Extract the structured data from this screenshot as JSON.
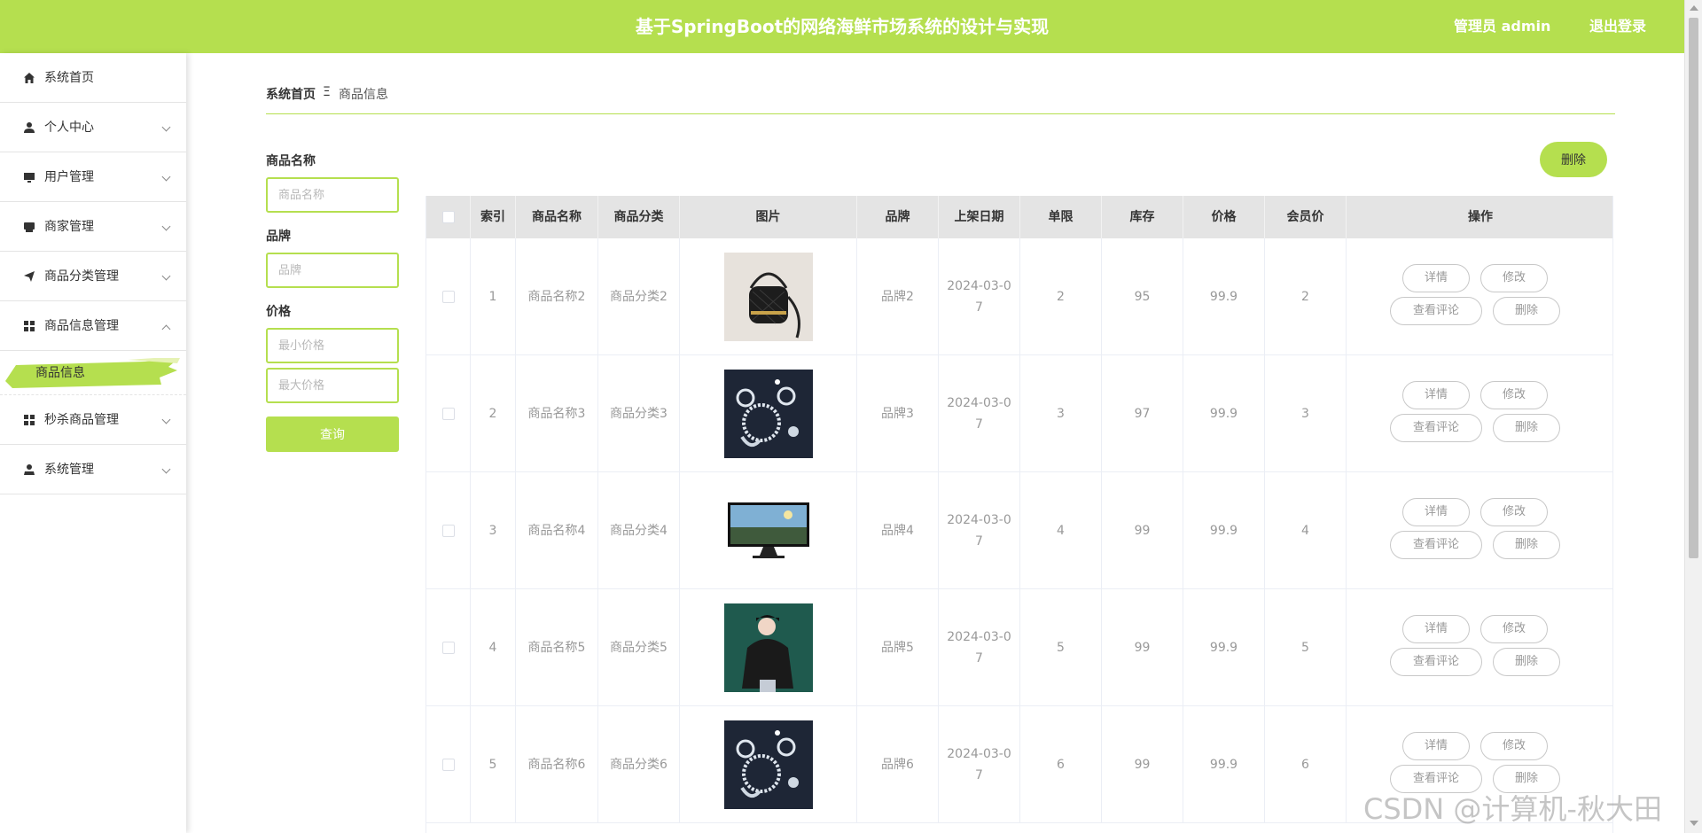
{
  "header": {
    "title": "基于SpringBoot的网络海鲜市场系统的设计与实现",
    "user": "管理员 admin",
    "logout": "退出登录",
    "accent_color": "#b5df4f"
  },
  "sidebar": {
    "items": [
      {
        "label": "系统首页",
        "icon": "home-icon"
      },
      {
        "label": "个人中心",
        "icon": "user-icon"
      },
      {
        "label": "用户管理",
        "icon": "monitor-icon"
      },
      {
        "label": "商家管理",
        "icon": "store-icon"
      },
      {
        "label": "商品分类管理",
        "icon": "send-icon"
      },
      {
        "label": "商品信息管理",
        "icon": "grid-icon"
      },
      {
        "label": "秒杀商品管理",
        "icon": "grid-icon"
      },
      {
        "label": "系统管理",
        "icon": "admin-icon"
      }
    ],
    "submenu_active": "商品信息"
  },
  "breadcrumb": {
    "home": "系统首页",
    "separator": "Ξ",
    "current": "商品信息"
  },
  "search": {
    "name_label": "商品名称",
    "name_placeholder": "商品名称",
    "brand_label": "品牌",
    "brand_placeholder": "品牌",
    "price_label": "价格",
    "min_placeholder": "最小价格",
    "max_placeholder": "最大价格",
    "submit": "查询"
  },
  "toolbar": {
    "delete": "删除"
  },
  "table": {
    "headers": [
      "",
      "索引",
      "商品名称",
      "商品分类",
      "图片",
      "品牌",
      "上架日期",
      "单限",
      "库存",
      "价格",
      "会员价",
      "操作"
    ],
    "rows": [
      {
        "index": "1",
        "name": "商品名称2",
        "category": "商品分类2",
        "image": "bag-image",
        "brand": "品牌2",
        "date": "2024-03-07",
        "limit": "2",
        "stock": "95",
        "price": "99.9",
        "member_price": "2"
      },
      {
        "index": "2",
        "name": "商品名称3",
        "category": "商品分类3",
        "image": "jewelry-image",
        "brand": "品牌3",
        "date": "2024-03-07",
        "limit": "3",
        "stock": "97",
        "price": "99.9",
        "member_price": "3"
      },
      {
        "index": "3",
        "name": "商品名称4",
        "category": "商品分类4",
        "image": "monitor-image",
        "brand": "品牌4",
        "date": "2024-03-07",
        "limit": "4",
        "stock": "99",
        "price": "99.9",
        "member_price": "4"
      },
      {
        "index": "4",
        "name": "商品名称5",
        "category": "商品分类5",
        "image": "person-image",
        "brand": "品牌5",
        "date": "2024-03-07",
        "limit": "5",
        "stock": "99",
        "price": "99.9",
        "member_price": "5"
      },
      {
        "index": "5",
        "name": "商品名称6",
        "category": "商品分类6",
        "image": "jewelry-image",
        "brand": "品牌6",
        "date": "2024-03-07",
        "limit": "6",
        "stock": "99",
        "price": "99.9",
        "member_price": "6"
      }
    ],
    "actions": {
      "detail": "详情",
      "edit": "修改",
      "comments": "查看评论",
      "delete": "删除"
    }
  },
  "watermark": "CSDN @计算机-秋大田"
}
